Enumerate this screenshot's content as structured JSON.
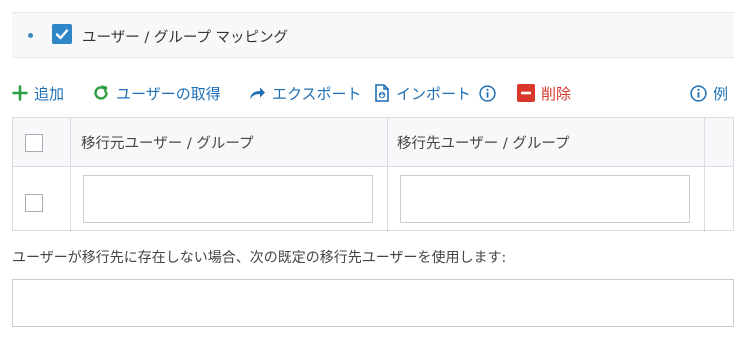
{
  "section": {
    "title": "ユーザー / グループ マッピング",
    "enabled": true
  },
  "toolbar": {
    "add": "追加",
    "fetch_users": "ユーザーの取得",
    "export": "エクスポート",
    "import": "インポート",
    "delete": "削除",
    "example": "例"
  },
  "table": {
    "columns": [
      "移行元ユーザー / グループ",
      "移行先ユーザー / グループ"
    ],
    "rows": [
      {
        "checked": false,
        "source": "",
        "target": ""
      }
    ]
  },
  "default_target": {
    "label": "ユーザーが移行先に存在しない場合、次の既定の移行先ユーザーを使用します:",
    "value": ""
  },
  "colors": {
    "accent": "#1f6fb5",
    "add_green": "#2ea043",
    "delete_red": "#d9372b",
    "checkbox_blue": "#2e86c9"
  }
}
